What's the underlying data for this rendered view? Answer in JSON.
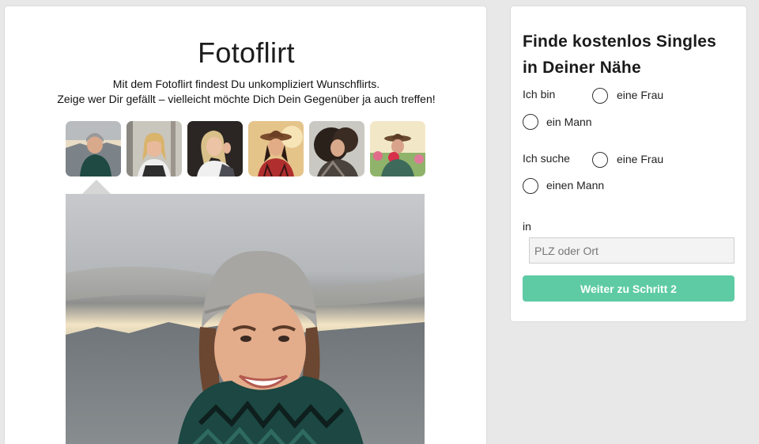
{
  "main": {
    "title": "Fotoflirt",
    "intro_line1": "Mit dem Fotoflirt findest Du unkompliziert Wunschflirts.",
    "intro_line2": "Zeige wer Dir gefällt – vielleicht möchte Dich Dein Gegenüber ja auch treffen!",
    "thumbnails": [
      "profile-photo-1",
      "profile-photo-2",
      "profile-photo-3",
      "profile-photo-4",
      "profile-photo-5",
      "profile-photo-6"
    ],
    "selected_thumbnail": 0
  },
  "sidebar": {
    "title": "Finde kostenlos Singles in Deiner Nähe",
    "i_am_label": "Ich bin",
    "i_am_options": [
      "eine Frau",
      "ein Mann"
    ],
    "seeking_label": "Ich suche",
    "seeking_options": [
      "eine Frau",
      "einen Mann"
    ],
    "location_label": "in",
    "location_placeholder": "PLZ oder Ort",
    "next_button_label": "Weiter zu Schritt 2"
  },
  "colors": {
    "accent": "#5ecba5",
    "background": "#e8e8e8",
    "card": "#ffffff"
  }
}
